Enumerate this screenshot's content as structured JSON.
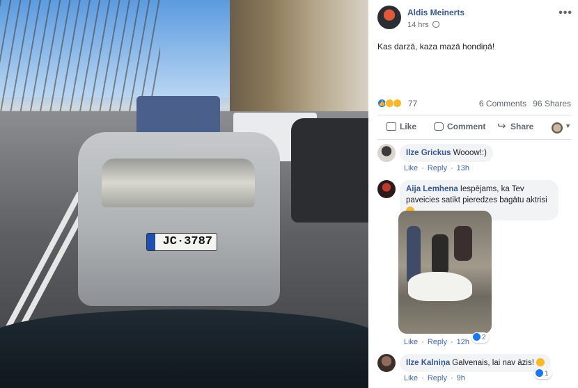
{
  "photo": {
    "plate_text": "JC·3787",
    "alt_subject": "street-photo"
  },
  "post": {
    "author": "Aldis Meinerts",
    "time": "14 hrs",
    "text": "Kas darzā, kaza mazā hondiņā!",
    "reaction_count": "77",
    "comments": "6 Comments",
    "shares": "96 Shares",
    "more": "•••"
  },
  "actions": {
    "like": "Like",
    "comment": "Comment",
    "share": "Share"
  },
  "comments": [
    {
      "name": "Ilze Grickus",
      "text": "Wooow!:)",
      "like": "Like",
      "reply": "Reply",
      "time": "13h"
    },
    {
      "name": "Aija Lemhena",
      "text": "Iespējams, ka Tev paveicies satikt pieredzes bagātu aktrisi",
      "like": "Like",
      "reply": "Reply",
      "time": "12h",
      "reactions": "2"
    },
    {
      "name": "Ilze Kalniņa",
      "text": "Galvenais, lai nav āzis!",
      "like": "Like",
      "reply": "Reply",
      "time": "9h",
      "reactions": "1"
    }
  ],
  "colors": {
    "link": "#385898",
    "like_blue": "#1877f2",
    "bubble": "#f2f3f5"
  }
}
